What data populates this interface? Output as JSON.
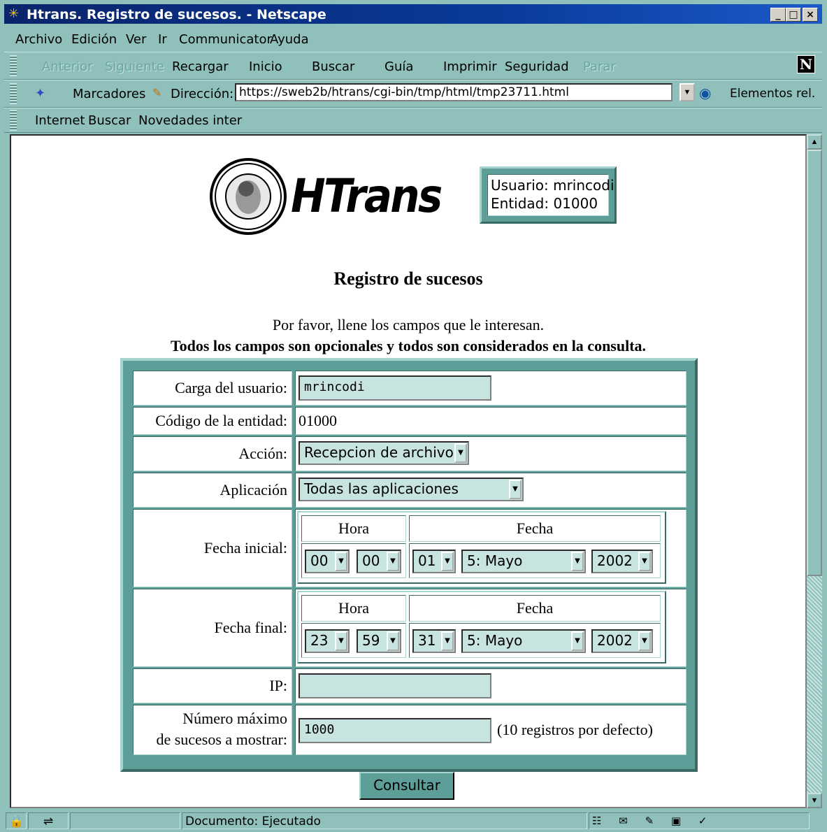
{
  "window": {
    "title": "Htrans. Registro de sucesos. - Netscape",
    "min": "_",
    "max": "□",
    "close": "×"
  },
  "menu": [
    "Archivo",
    "Edición",
    "Ver",
    "Ir",
    "Communicator",
    "Ayuda"
  ],
  "nav": {
    "back": "Anterior",
    "forward": "Siguiente",
    "reload": "Recargar",
    "home": "Inicio",
    "search": "Buscar",
    "guide": "Guía",
    "print": "Imprimir",
    "security": "Seguridad",
    "stop": "Parar"
  },
  "location": {
    "bookmarks": "Marcadores",
    "address_label": "Dirección:",
    "url": "https://sweb2b/htrans/cgi-bin/tmp/html/tmp23711.html",
    "related": "Elementos rel."
  },
  "personal": [
    "Internet",
    "Buscar",
    "Novedades inter"
  ],
  "header": {
    "logo_text": "HTrans",
    "user_line": "Usuario: mrincodi",
    "entity_line": "Entidad: 01000"
  },
  "page": {
    "title": "Registro de sucesos",
    "intro": "Por favor, llene los campos que le interesan.",
    "note": "Todos los campos son opcionales y todos son considerados en la consulta."
  },
  "form": {
    "user_label": "Carga del usuario:",
    "user_value": "mrincodi",
    "entity_label": "Código de la entidad:",
    "entity_value": "01000",
    "action_label": "Acción:",
    "action_value": "Recepcion de archivo",
    "app_label": "Aplicación",
    "app_value": "Todas las aplicaciones",
    "hour_head": "Hora",
    "date_head": "Fecha",
    "start_label": "Fecha inicial:",
    "start": {
      "hour": "00",
      "min": "00",
      "day": "01",
      "month": "5: Mayo",
      "year": "2002"
    },
    "end_label": "Fecha final:",
    "end": {
      "hour": "23",
      "min": "59",
      "day": "31",
      "month": "5: Mayo",
      "year": "2002"
    },
    "ip_label": "IP:",
    "ip_value": "",
    "max_label_1": "Número máximo",
    "max_label_2": "de sucesos a mostrar:",
    "max_value": "1000",
    "max_hint": "(10 registros por defecto)",
    "submit": "Consultar"
  },
  "status": {
    "text": "Documento: Ejecutado"
  }
}
